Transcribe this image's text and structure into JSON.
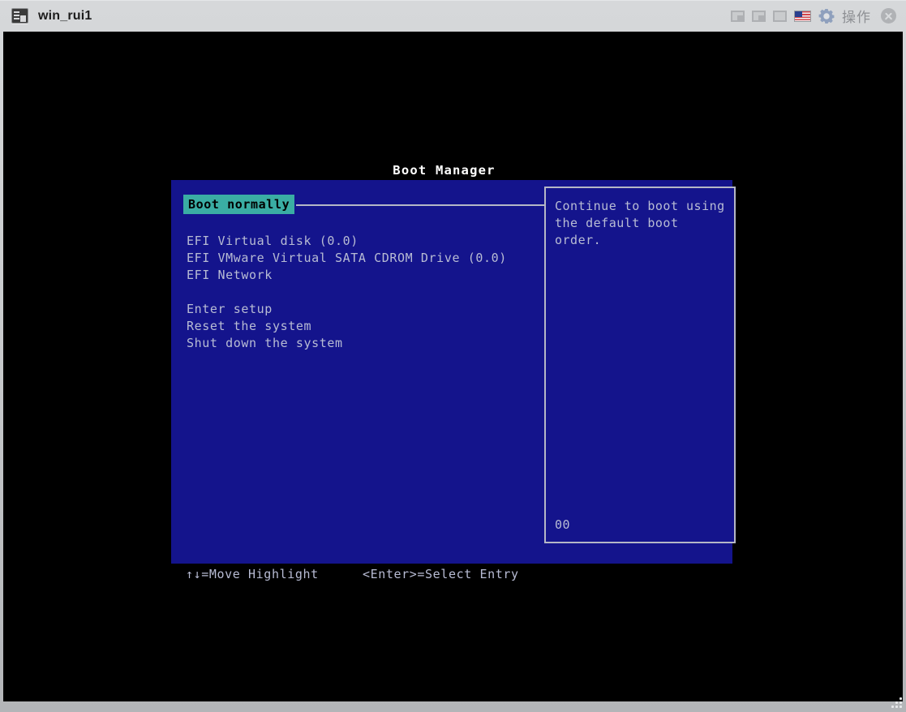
{
  "window": {
    "title": "win_rui1",
    "app_icon": "terminal-icon",
    "controls": {
      "minimize": "minimize-button",
      "restore": "restore-button",
      "maximize": "maximize-button",
      "language_flag": "us-flag-icon",
      "gear": "gear-icon",
      "action_label": "操作",
      "close": "close-button"
    },
    "resize_grip": "resize-grip"
  },
  "bios": {
    "title": "Boot Manager",
    "menu": [
      {
        "label": "Boot normally",
        "selected": true
      },
      {
        "label": "",
        "selected": false
      },
      {
        "label": "EFI Virtual disk (0.0)",
        "selected": false
      },
      {
        "label": "EFI VMware Virtual SATA CDROM Drive (0.0)",
        "selected": false
      },
      {
        "label": "EFI Network",
        "selected": false
      },
      {
        "label": "",
        "selected": false
      },
      {
        "label": "Enter setup",
        "selected": false
      },
      {
        "label": "Reset the system",
        "selected": false
      },
      {
        "label": "Shut down the system",
        "selected": false
      }
    ],
    "help": {
      "text": "Continue to boot using\nthe default boot order.",
      "code": "00"
    },
    "hints": {
      "move": "↑↓=Move Highlight",
      "select": "<Enter>=Select Entry"
    },
    "colors": {
      "panel_blue": "#14148c",
      "highlight_teal": "#3aada4",
      "text_lavender": "#b8bcd4",
      "border_gray": "#b5b7c6",
      "title_white": "#ffffff",
      "screen_black": "#000000"
    }
  }
}
